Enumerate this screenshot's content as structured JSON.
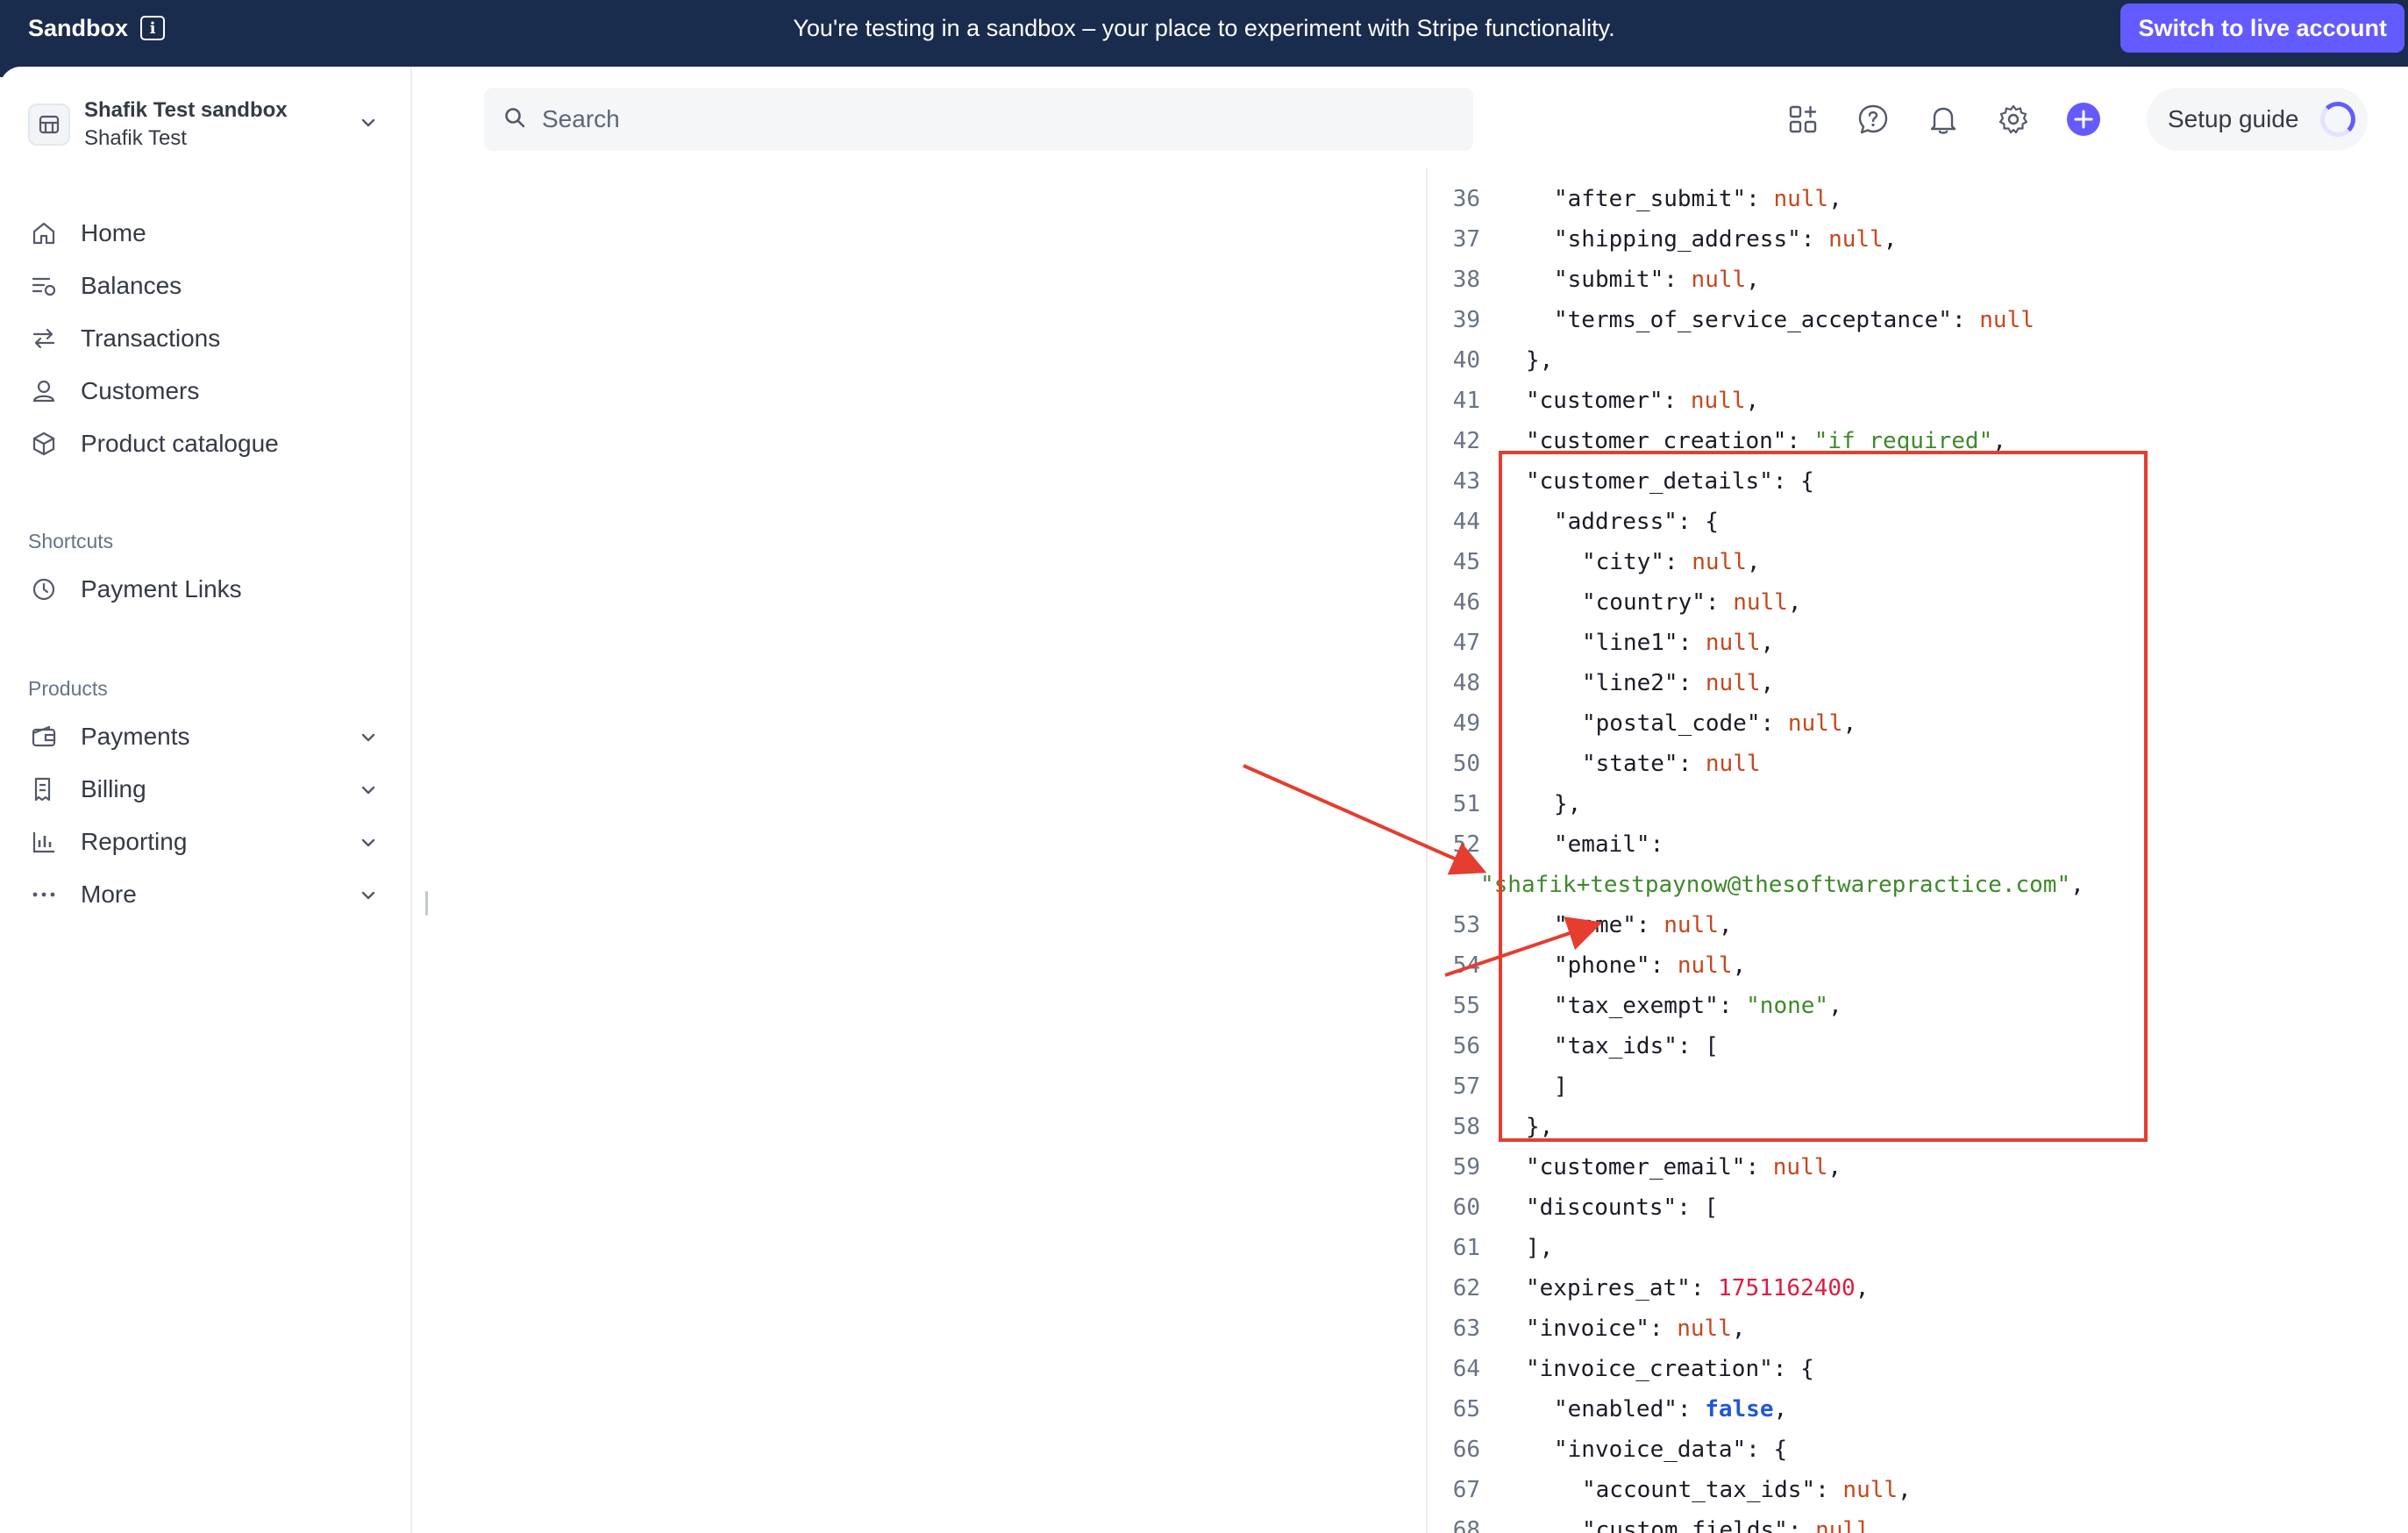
{
  "banner": {
    "brand": "Sandbox",
    "message": "You're testing in a sandbox – your place to experiment with Stripe functionality.",
    "live_button": "Switch to live account",
    "bg_color": "#1a2c4e",
    "accent_color": "#635bff"
  },
  "account": {
    "name": "Shafik Test sandbox",
    "sub": "Shafik Test"
  },
  "nav": {
    "main": [
      {
        "label": "Home",
        "icon": "home-icon"
      },
      {
        "label": "Balances",
        "icon": "balances-icon"
      },
      {
        "label": "Transactions",
        "icon": "transactions-icon"
      },
      {
        "label": "Customers",
        "icon": "customers-icon"
      },
      {
        "label": "Product catalogue",
        "icon": "product-catalogue-icon"
      }
    ],
    "shortcuts_title": "Shortcuts",
    "shortcuts": [
      {
        "label": "Payment Links",
        "icon": "clock-icon"
      }
    ],
    "products_title": "Products",
    "products": [
      {
        "label": "Payments",
        "icon": "wallet-icon"
      },
      {
        "label": "Billing",
        "icon": "billing-icon"
      },
      {
        "label": "Reporting",
        "icon": "reporting-icon"
      },
      {
        "label": "More",
        "icon": "more-icon"
      }
    ]
  },
  "header": {
    "search_placeholder": "Search",
    "setup_guide": "Setup guide",
    "icons": [
      "apps-icon",
      "help-icon",
      "bell-icon",
      "gear-icon",
      "plus-icon"
    ]
  },
  "code": [
    {
      "ln": "36",
      "indent": 2,
      "tokens": [
        [
          "k",
          "\"after_submit\""
        ],
        [
          "punc",
          ": "
        ],
        [
          "null",
          "null"
        ],
        [
          "punc",
          ","
        ]
      ]
    },
    {
      "ln": "37",
      "indent": 2,
      "tokens": [
        [
          "k",
          "\"shipping_address\""
        ],
        [
          "punc",
          ": "
        ],
        [
          "null",
          "null"
        ],
        [
          "punc",
          ","
        ]
      ]
    },
    {
      "ln": "38",
      "indent": 2,
      "tokens": [
        [
          "k",
          "\"submit\""
        ],
        [
          "punc",
          ": "
        ],
        [
          "null",
          "null"
        ],
        [
          "punc",
          ","
        ]
      ]
    },
    {
      "ln": "39",
      "indent": 2,
      "tokens": [
        [
          "k",
          "\"terms_of_service_acceptance\""
        ],
        [
          "punc",
          ": "
        ],
        [
          "null",
          "null"
        ]
      ]
    },
    {
      "ln": "40",
      "indent": 1,
      "tokens": [
        [
          "punc",
          "},"
        ]
      ]
    },
    {
      "ln": "41",
      "indent": 1,
      "tokens": [
        [
          "k",
          "\"customer\""
        ],
        [
          "punc",
          ": "
        ],
        [
          "null",
          "null"
        ],
        [
          "punc",
          ","
        ]
      ]
    },
    {
      "ln": "42",
      "indent": 1,
      "tokens": [
        [
          "k",
          "\"customer_creation\""
        ],
        [
          "punc",
          ": "
        ],
        [
          "str",
          "\"if_required\""
        ],
        [
          "punc",
          ","
        ]
      ]
    },
    {
      "ln": "43",
      "indent": 1,
      "tokens": [
        [
          "k",
          "\"customer_details\""
        ],
        [
          "punc",
          ": {"
        ]
      ]
    },
    {
      "ln": "44",
      "indent": 2,
      "tokens": [
        [
          "k",
          "\"address\""
        ],
        [
          "punc",
          ": {"
        ]
      ]
    },
    {
      "ln": "45",
      "indent": 3,
      "tokens": [
        [
          "k",
          "\"city\""
        ],
        [
          "punc",
          ": "
        ],
        [
          "null",
          "null"
        ],
        [
          "punc",
          ","
        ]
      ]
    },
    {
      "ln": "46",
      "indent": 3,
      "tokens": [
        [
          "k",
          "\"country\""
        ],
        [
          "punc",
          ": "
        ],
        [
          "null",
          "null"
        ],
        [
          "punc",
          ","
        ]
      ]
    },
    {
      "ln": "47",
      "indent": 3,
      "tokens": [
        [
          "k",
          "\"line1\""
        ],
        [
          "punc",
          ": "
        ],
        [
          "null",
          "null"
        ],
        [
          "punc",
          ","
        ]
      ]
    },
    {
      "ln": "48",
      "indent": 3,
      "tokens": [
        [
          "k",
          "\"line2\""
        ],
        [
          "punc",
          ": "
        ],
        [
          "null",
          "null"
        ],
        [
          "punc",
          ","
        ]
      ]
    },
    {
      "ln": "49",
      "indent": 3,
      "tokens": [
        [
          "k",
          "\"postal_code\""
        ],
        [
          "punc",
          ": "
        ],
        [
          "null",
          "null"
        ],
        [
          "punc",
          ","
        ]
      ]
    },
    {
      "ln": "50",
      "indent": 3,
      "tokens": [
        [
          "k",
          "\"state\""
        ],
        [
          "punc",
          ": "
        ],
        [
          "null",
          "null"
        ]
      ]
    },
    {
      "ln": "51",
      "indent": 2,
      "tokens": [
        [
          "punc",
          "},"
        ]
      ]
    },
    {
      "ln": "52",
      "indent": 2,
      "tokens": [
        [
          "k",
          "\"email\""
        ],
        [
          "punc",
          ":"
        ]
      ]
    },
    {
      "ln": "",
      "indent": 0,
      "tokens": [
        [
          "str",
          "\"shafik+testpaynow@thesoftwarepractice.com\""
        ],
        [
          "punc",
          ","
        ]
      ]
    },
    {
      "ln": "53",
      "indent": 2,
      "tokens": [
        [
          "k",
          "\"name\""
        ],
        [
          "punc",
          ": "
        ],
        [
          "null",
          "null"
        ],
        [
          "punc",
          ","
        ]
      ]
    },
    {
      "ln": "54",
      "indent": 2,
      "tokens": [
        [
          "k",
          "\"phone\""
        ],
        [
          "punc",
          ": "
        ],
        [
          "null",
          "null"
        ],
        [
          "punc",
          ","
        ]
      ]
    },
    {
      "ln": "55",
      "indent": 2,
      "tokens": [
        [
          "k",
          "\"tax_exempt\""
        ],
        [
          "punc",
          ": "
        ],
        [
          "str",
          "\"none\""
        ],
        [
          "punc",
          ","
        ]
      ]
    },
    {
      "ln": "56",
      "indent": 2,
      "tokens": [
        [
          "k",
          "\"tax_ids\""
        ],
        [
          "punc",
          ": ["
        ]
      ]
    },
    {
      "ln": "57",
      "indent": 2,
      "tokens": [
        [
          "punc",
          "]"
        ]
      ]
    },
    {
      "ln": "58",
      "indent": 1,
      "tokens": [
        [
          "punc",
          "},"
        ]
      ]
    },
    {
      "ln": "59",
      "indent": 1,
      "tokens": [
        [
          "k",
          "\"customer_email\""
        ],
        [
          "punc",
          ": "
        ],
        [
          "null",
          "null"
        ],
        [
          "punc",
          ","
        ]
      ]
    },
    {
      "ln": "60",
      "indent": 1,
      "tokens": [
        [
          "k",
          "\"discounts\""
        ],
        [
          "punc",
          ": ["
        ]
      ]
    },
    {
      "ln": "61",
      "indent": 1,
      "tokens": [
        [
          "punc",
          "],"
        ]
      ]
    },
    {
      "ln": "62",
      "indent": 1,
      "tokens": [
        [
          "k",
          "\"expires_at\""
        ],
        [
          "punc",
          ": "
        ],
        [
          "num",
          "1751162400"
        ],
        [
          "punc",
          ","
        ]
      ]
    },
    {
      "ln": "63",
      "indent": 1,
      "tokens": [
        [
          "k",
          "\"invoice\""
        ],
        [
          "punc",
          ": "
        ],
        [
          "null",
          "null"
        ],
        [
          "punc",
          ","
        ]
      ]
    },
    {
      "ln": "64",
      "indent": 1,
      "tokens": [
        [
          "k",
          "\"invoice_creation\""
        ],
        [
          "punc",
          ": {"
        ]
      ]
    },
    {
      "ln": "65",
      "indent": 2,
      "tokens": [
        [
          "k",
          "\"enabled\""
        ],
        [
          "punc",
          ": "
        ],
        [
          "bool",
          "false"
        ],
        [
          "punc",
          ","
        ]
      ]
    },
    {
      "ln": "66",
      "indent": 2,
      "tokens": [
        [
          "k",
          "\"invoice_data\""
        ],
        [
          "punc",
          ": {"
        ]
      ]
    },
    {
      "ln": "67",
      "indent": 3,
      "tokens": [
        [
          "k",
          "\"account_tax_ids\""
        ],
        [
          "punc",
          ": "
        ],
        [
          "null",
          "null"
        ],
        [
          "punc",
          ","
        ]
      ]
    },
    {
      "ln": "68",
      "indent": 3,
      "tokens": [
        [
          "k",
          "\"custom_fields\""
        ],
        [
          "punc",
          ": "
        ],
        [
          "null",
          "null"
        ],
        [
          "punc",
          ","
        ]
      ]
    }
  ]
}
